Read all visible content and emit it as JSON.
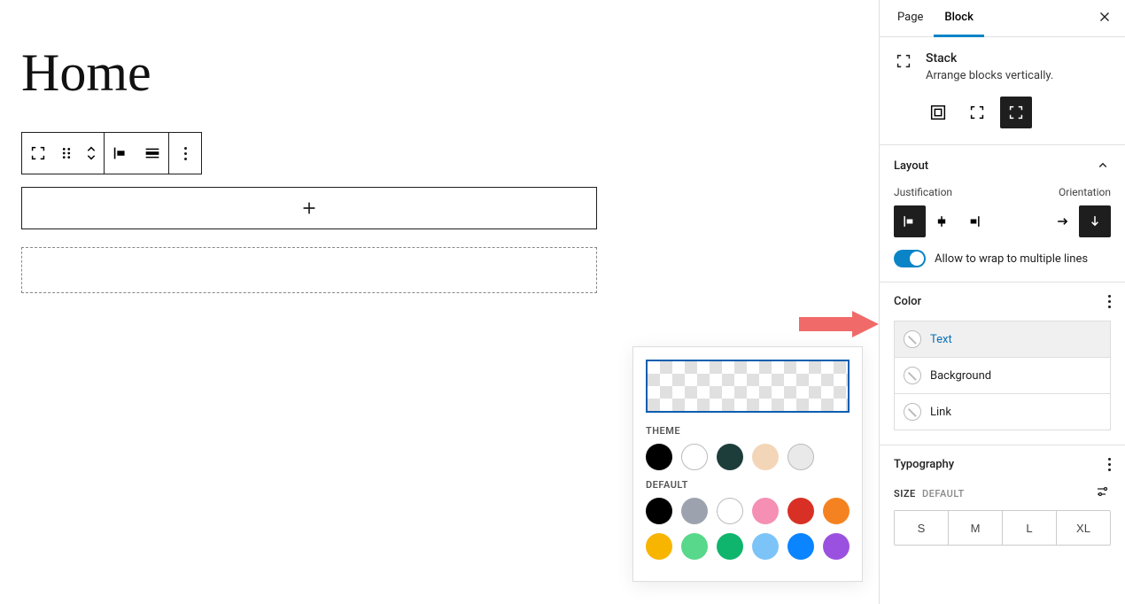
{
  "page_title": "Home",
  "sidebar": {
    "tabs": {
      "page": "Page",
      "block": "Block"
    },
    "block_name": "Stack",
    "block_desc": "Arrange blocks vertically.",
    "layout": {
      "label": "Layout",
      "justification_label": "Justification",
      "orientation_label": "Orientation",
      "wrap_label": "Allow to wrap to multiple lines"
    },
    "color": {
      "label": "Color",
      "items": [
        "Text",
        "Background",
        "Link"
      ]
    },
    "typography": {
      "label": "Typography",
      "size_label": "SIZE",
      "size_default": "DEFAULT",
      "sizes": [
        "S",
        "M",
        "L",
        "XL"
      ]
    }
  },
  "color_popover": {
    "theme_label": "Theme",
    "default_label": "Default",
    "theme_colors": [
      "#000000",
      "#ffffff",
      "#1d3d3a",
      "#f3d6b7",
      "#e9e9e9"
    ],
    "default_colors_row1": [
      "#000000",
      "#9ca3af",
      "#ffffff",
      "#f58fb3",
      "#d93025",
      "#f58220"
    ],
    "default_colors_row2": [
      "#f7b500",
      "#57d88a",
      "#0fb56d",
      "#7cc4f8",
      "#0a84ff",
      "#9b51e0"
    ]
  }
}
